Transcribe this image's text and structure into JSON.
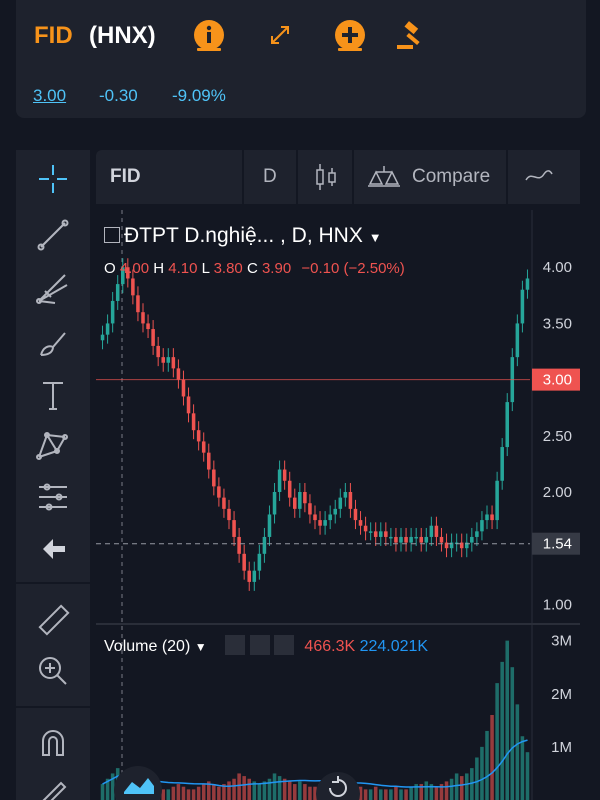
{
  "quote": {
    "ticker": "FID",
    "exchange": "(HNX)",
    "price": "3.00",
    "change": "-0.30",
    "change_pct": "-9.09%",
    "accent_color": "#f7931a",
    "quote_color": "#4fc3f7"
  },
  "quote_icons": [
    "info-icon",
    "expand-icon",
    "add-icon",
    "auction-icon"
  ],
  "toolbar": {
    "symbol": "FID",
    "interval": "D",
    "compare_label": "Compare"
  },
  "left_tools": [
    "crosshair-icon",
    "trend-line-icon",
    "fib-icon",
    "brush-icon",
    "text-icon",
    "pattern-icon",
    "prediction-icon",
    "back-arrow-icon",
    "ruler-icon",
    "zoom-in-icon",
    "magnet-icon",
    "pencil-icon"
  ],
  "legend": {
    "title": "ĐTPT D.nghiệ...",
    "interval": ", D, HNX",
    "o_label": "O",
    "o": "4.00",
    "h_label": "H",
    "h": "4.10",
    "l_label": "L",
    "l": "3.80",
    "c_label": "C",
    "c": "3.90",
    "chg": "−0.10 (−2.50%)"
  },
  "volume_legend": {
    "label": "Volume (20)",
    "v1": "466.3K",
    "v2": "224.021K"
  },
  "price_axis": {
    "ticks": [
      "4.00",
      "3.50",
      "3.00",
      "2.50",
      "2.00",
      "1.54",
      "1.00"
    ],
    "current_price": "3.00",
    "crosshair_price": "1.54"
  },
  "volume_axis": {
    "ticks": [
      "3M",
      "2M",
      "1M"
    ]
  },
  "chart_data": {
    "type": "candlestick",
    "ylim": [
      0.95,
      4.1
    ],
    "close_series": [
      3.4,
      3.5,
      3.7,
      3.85,
      4.0,
      3.9,
      3.75,
      3.6,
      3.5,
      3.45,
      3.3,
      3.2,
      3.15,
      3.2,
      3.1,
      3.0,
      2.85,
      2.7,
      2.55,
      2.45,
      2.35,
      2.2,
      2.05,
      1.95,
      1.85,
      1.75,
      1.6,
      1.45,
      1.3,
      1.2,
      1.3,
      1.45,
      1.6,
      1.8,
      2.0,
      2.2,
      2.1,
      1.95,
      1.85,
      2.0,
      1.9,
      1.8,
      1.75,
      1.7,
      1.75,
      1.8,
      1.85,
      1.95,
      2.0,
      1.85,
      1.75,
      1.7,
      1.65,
      1.65,
      1.6,
      1.65,
      1.6,
      1.6,
      1.55,
      1.6,
      1.55,
      1.6,
      1.6,
      1.55,
      1.6,
      1.7,
      1.6,
      1.55,
      1.5,
      1.55,
      1.55,
      1.5,
      1.55,
      1.6,
      1.65,
      1.75,
      1.8,
      1.75,
      2.1,
      2.4,
      2.8,
      3.2,
      3.5,
      3.8,
      3.9
    ],
    "volume_series": [
      0.3,
      0.4,
      0.5,
      0.6,
      0.5,
      0.4,
      0.3,
      0.3,
      0.25,
      0.2,
      0.2,
      0.25,
      0.2,
      0.2,
      0.25,
      0.3,
      0.25,
      0.2,
      0.2,
      0.25,
      0.3,
      0.35,
      0.3,
      0.25,
      0.3,
      0.35,
      0.4,
      0.5,
      0.45,
      0.4,
      0.35,
      0.3,
      0.35,
      0.4,
      0.5,
      0.45,
      0.4,
      0.35,
      0.3,
      0.35,
      0.3,
      0.25,
      0.25,
      0.3,
      0.3,
      0.25,
      0.3,
      0.35,
      0.3,
      0.25,
      0.2,
      0.25,
      0.2,
      0.2,
      0.25,
      0.2,
      0.2,
      0.2,
      0.25,
      0.2,
      0.2,
      0.25,
      0.3,
      0.3,
      0.35,
      0.3,
      0.25,
      0.3,
      0.35,
      0.4,
      0.5,
      0.45,
      0.5,
      0.6,
      0.8,
      1.0,
      1.3,
      1.6,
      2.2,
      2.6,
      3.0,
      2.5,
      1.8,
      1.2,
      0.9
    ],
    "up_color": "#26a69a",
    "down_color": "#ef5350",
    "current_price": 3.0,
    "crosshair_price": 1.54
  }
}
